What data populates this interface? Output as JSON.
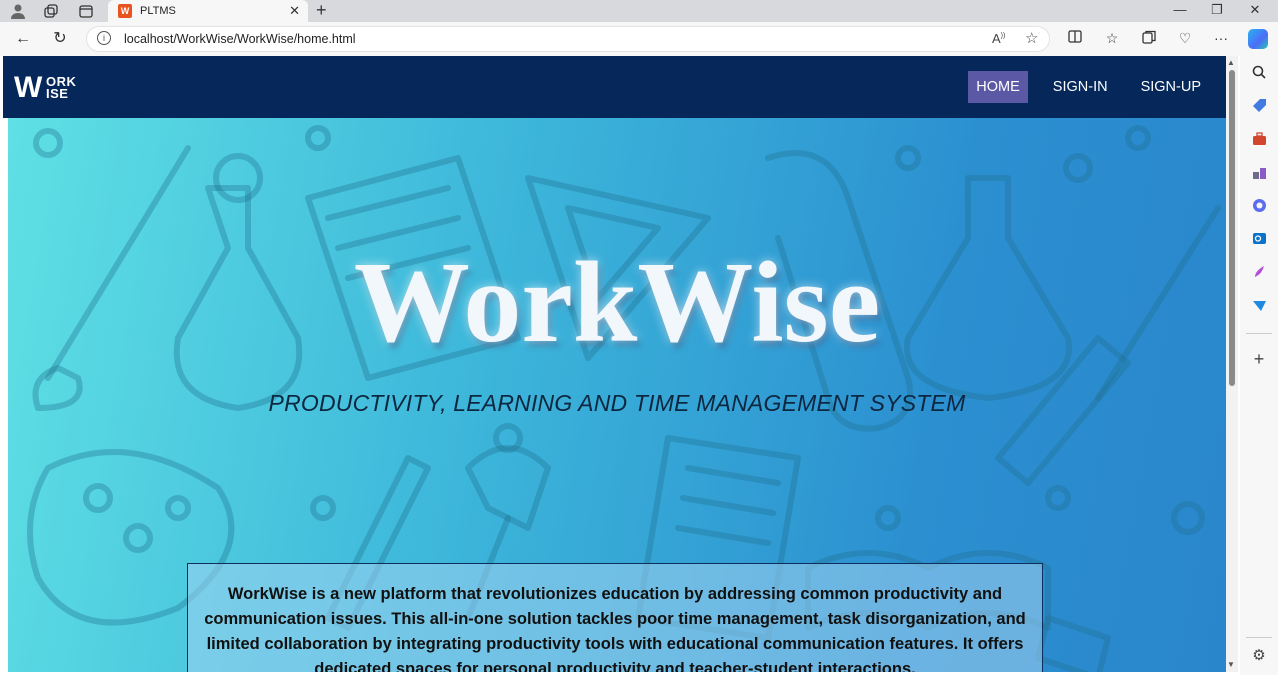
{
  "browser": {
    "tab_title": "PLTMS",
    "tab_favicon": "workwise-favicon",
    "url": "localhost/WorkWise/WorkWise/home.html",
    "icons": {
      "profile": "profile-icon",
      "workspaces": "workspaces-icon",
      "tab_actions": "tab-actions-icon",
      "new_tab": "plus-icon",
      "back": "back-arrow-icon",
      "refresh": "refresh-icon",
      "info": "info-icon",
      "read_aloud": "read-aloud-icon",
      "favorite": "star-icon",
      "split_screen": "split-screen-icon",
      "favorites": "favorites-icon",
      "collections": "collections-icon",
      "browser_essentials": "heart-pulse-icon",
      "more": "more-icon",
      "copilot": "copilot-icon"
    }
  },
  "sidebar": {
    "icons": [
      "search-icon",
      "tag-icon",
      "toolbox-icon",
      "games-icon",
      "office-icon",
      "outlook-icon",
      "designer-icon",
      "send-icon",
      "add-icon",
      "settings-icon"
    ]
  },
  "site": {
    "logo_text_big": "W",
    "logo_text_top": "ORK",
    "logo_text_bottom": "ISE",
    "nav": [
      {
        "label": "HOME",
        "active": true
      },
      {
        "label": "SIGN-IN",
        "active": false
      },
      {
        "label": "SIGN-UP",
        "active": false
      }
    ],
    "hero_title": "WorkWise",
    "hero_subtitle": "PRODUCTIVITY, LEARNING AND TIME MANAGEMENT SYSTEM",
    "about_text": "WorkWise is a new platform that revolutionizes education by addressing common productivity and communication issues. This all-in-one solution tackles poor time management, task disorganization, and limited collaboration by integrating productivity tools with educational communication features. It offers dedicated spaces for personal productivity and teacher-student interactions."
  },
  "colors": {
    "header_bg": "#06275a",
    "nav_active_bg": "#5b59a6",
    "hero_gradient_start": "#5fe0e4",
    "hero_gradient_end": "#2a86cb"
  }
}
